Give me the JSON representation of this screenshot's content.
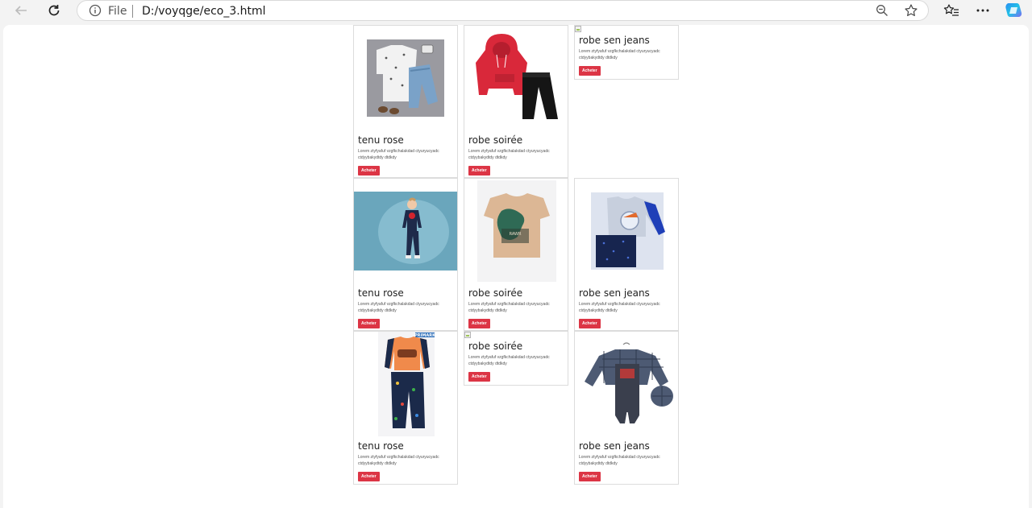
{
  "browser": {
    "address": {
      "scheme_label": "File",
      "url": "D:/voyqge/eco_3.html"
    },
    "icons": {
      "back": "back-arrow-icon",
      "reload": "reload-icon",
      "info": "info-icon",
      "zoom": "zoom-out-icon",
      "favorite": "star-icon",
      "favorites_list": "favorites-icon",
      "menu": "more-icon",
      "copilot": "copilot-icon"
    }
  },
  "products": [
    {
      "title": "tenu rose",
      "text": "Lorem ztyfyafuf vzgfkchalakdad ctyuryucyadc ctdyybakydtdy dtdkdy",
      "button": "Acheter",
      "image": "boy-white-shirt-jeans-outfit"
    },
    {
      "title": "robe soirée",
      "text": "Lorem ztyfyafuf vzgfkchalakdad ctyuryucyadc ctdyybakydtdy dtdkdy",
      "button": "Acheter",
      "image": "red-hoodie-black-pants"
    },
    {
      "title": "robe sen jeans",
      "text": "Lorem ztyfyafuf vzgfkchalakdad ctyuryucyadc ctdyybakydtdy dtdkdy",
      "button": "Acheter",
      "image": "broken-image"
    },
    {
      "title": "tenu rose",
      "text": "Lorem ztyfyafuf vzgfkchalakdad ctyuryucyadc ctdyybakydtdy dtdkdy",
      "button": "Acheter",
      "image": "boy-spiderman-pajamas"
    },
    {
      "title": "robe soirée",
      "text": "Lorem ztyfyafuf vzgfkchalakdad ctyuryucyadc ctdyybakydtdy dtdkdy",
      "button": "Acheter",
      "image": "dinosaur-tshirt"
    },
    {
      "title": "robe sen jeans",
      "text": "Lorem ztyfyafuf vzgfkchalakdad ctyuryucyadc ctdyybakydtdy dtdkdy",
      "button": "Acheter",
      "image": "astronaut-pajama-set"
    },
    {
      "title": "tenu rose",
      "text": "Lorem ztyfyafuf vzgfkchalakdad ctyuryucyadc ctdyybakydtdy dtdkdy",
      "button": "Acheter",
      "image": "orange-racecar-pajamas",
      "image_badge": "PRIMARK"
    },
    {
      "title": "robe soirée",
      "text": "Lorem ztyfyafuf vzgfkchalakdad ctyuryucyadc ctdyybakydtdy dtdkdy",
      "button": "Acheter",
      "image": "broken-image"
    },
    {
      "title": "robe sen jeans",
      "text": "Lorem ztyfyafuf vzgfkchalakdad ctyuryucyadc ctdyybakydtdy dtdkdy",
      "button": "Acheter",
      "image": "plaid-shirt-overalls-cap"
    }
  ],
  "colors": {
    "button": "#dc3545",
    "card_border": "#dcdcdc",
    "chrome": "#f3f3f3"
  }
}
